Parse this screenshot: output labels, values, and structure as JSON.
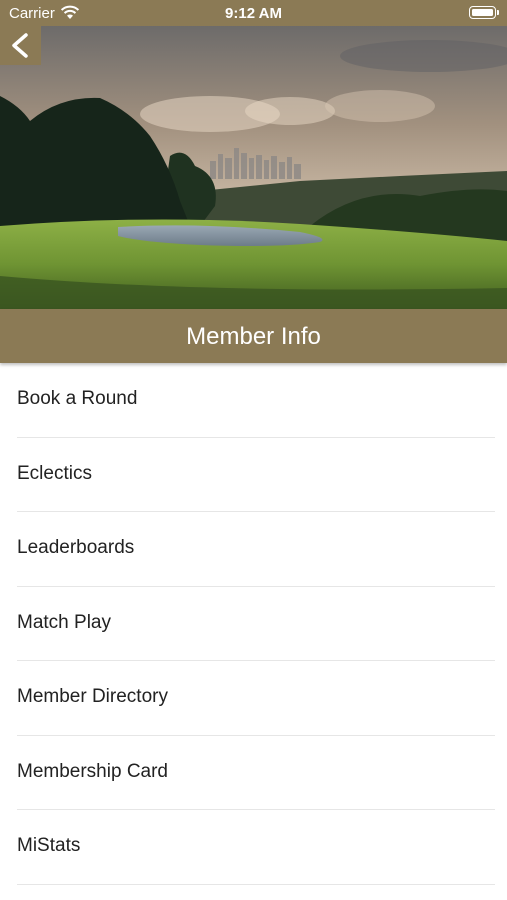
{
  "status_bar": {
    "carrier": "Carrier",
    "time": "9:12 AM",
    "icons": [
      "wifi-icon",
      "battery-icon"
    ]
  },
  "header": {
    "back_icon": "chevron-left-icon",
    "hero_image": "golf-course-with-city-skyline",
    "title": "Member Info"
  },
  "menu": {
    "items": [
      {
        "label": "Book a Round"
      },
      {
        "label": "Eclectics"
      },
      {
        "label": "Leaderboards"
      },
      {
        "label": "Match Play"
      },
      {
        "label": "Member Directory"
      },
      {
        "label": "Membership Card"
      },
      {
        "label": "MiStats"
      }
    ]
  },
  "colors": {
    "accent": "#8b7a55",
    "text": "#222222",
    "divider": "#e6e6e6"
  }
}
